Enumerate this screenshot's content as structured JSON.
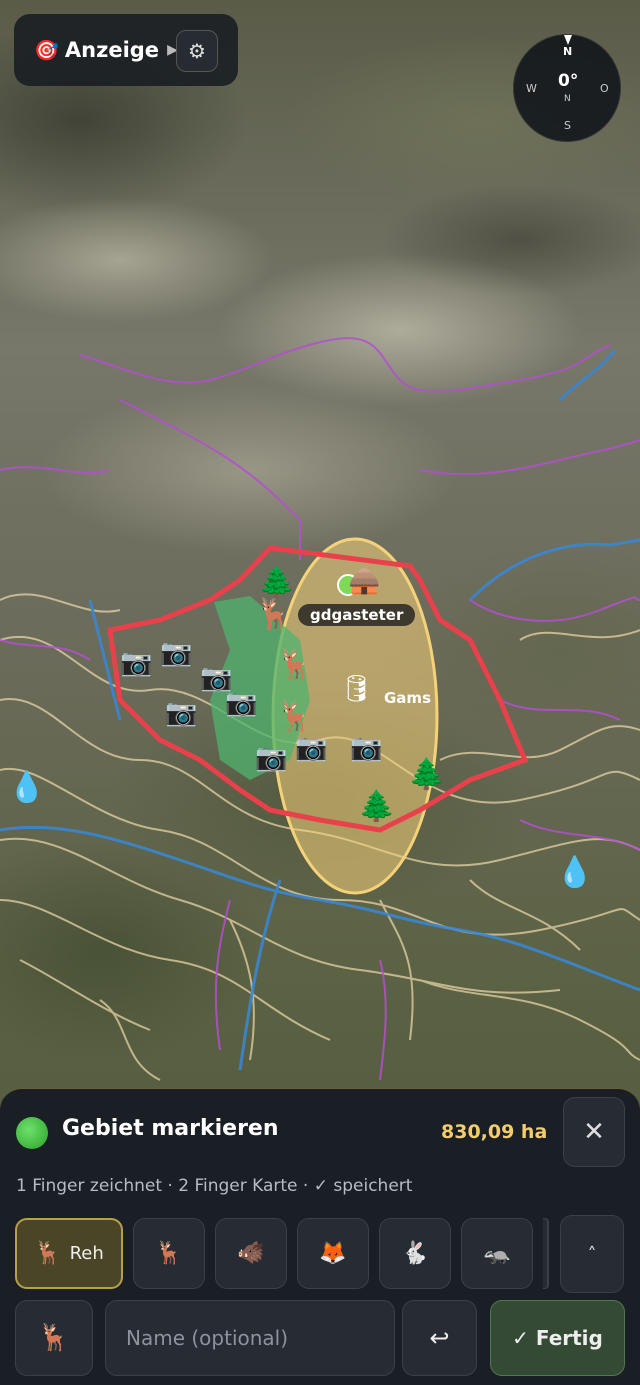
{
  "topbar": {
    "target_icon": "🎯",
    "label": "Anzeige",
    "arrow": "▶",
    "settings_icon": "⚙"
  },
  "compass": {
    "n": "N",
    "s": "S",
    "w": "W",
    "o": "O",
    "heading": "0°",
    "sub": "N"
  },
  "map": {
    "labels": {
      "hunt_label": "gdgasteter",
      "gams_label": "Gams"
    },
    "icons": {
      "water": "💧",
      "deer": "🦌",
      "tree": "🌲"
    },
    "colors": {
      "boundary": "#e8414b",
      "zone": "#f5d27a",
      "green_area": "#4fb36e",
      "river": "#3a86d1",
      "trail_purple": "#b44fd0",
      "contour": "#e6d3a6"
    }
  },
  "sheet": {
    "title": "Gebiet markieren",
    "area": "830,09 ha",
    "close_icon": "✕",
    "hint": "1 Finger zeichnet · 2 Finger Karte · ✓ speichert",
    "chips": [
      {
        "icon": "🦌",
        "label": "Reh"
      },
      {
        "icon": "🦌"
      },
      {
        "icon": "🐗"
      },
      {
        "icon": "🦊"
      },
      {
        "icon": "🐇"
      },
      {
        "icon": "🦡"
      }
    ],
    "expand_icon": "˄",
    "animal_icon": "🦌",
    "name_placeholder": "Name (optional)",
    "undo_icon": "↩",
    "done_label": "✓ Fertig"
  }
}
